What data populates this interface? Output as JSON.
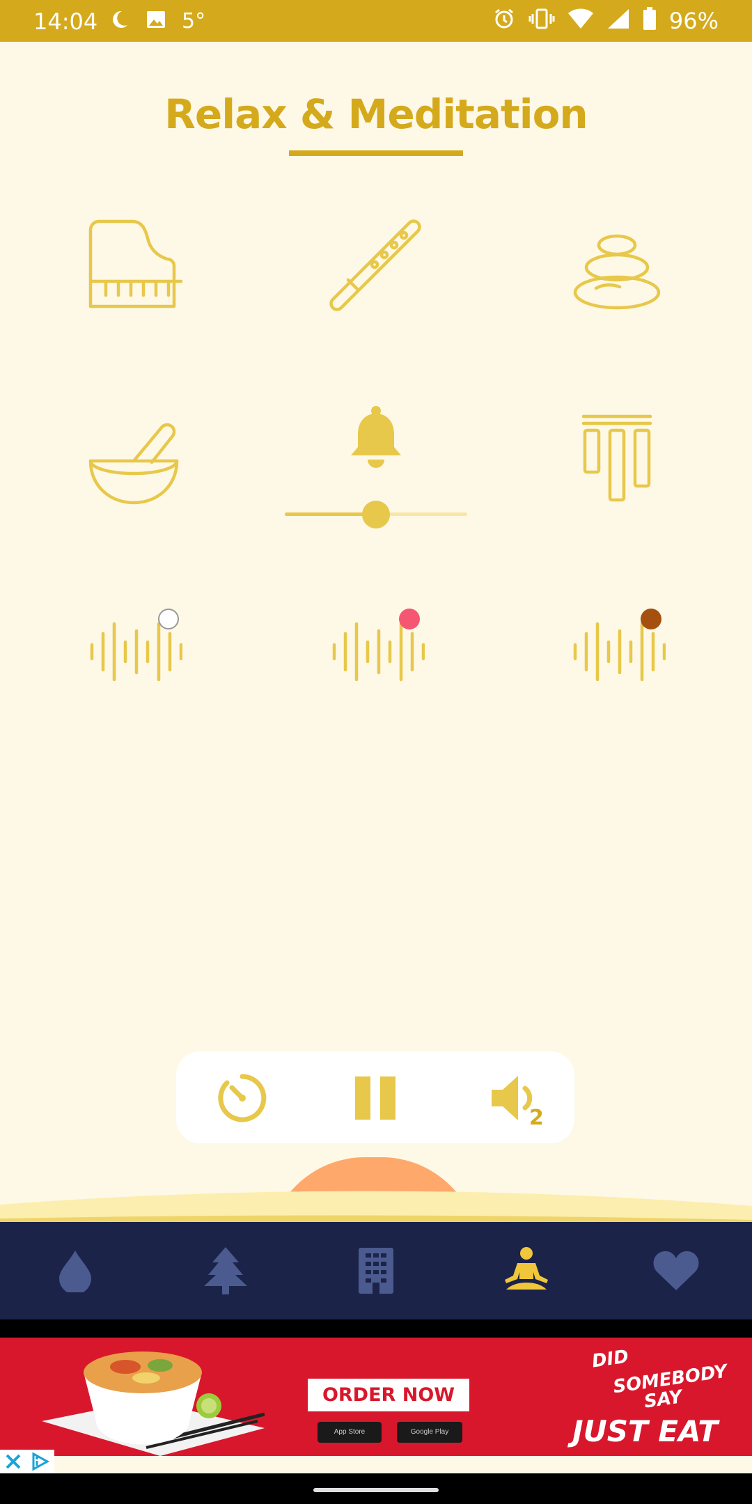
{
  "status_bar": {
    "time": "14:04",
    "temperature": "5°",
    "battery": "96%"
  },
  "page": {
    "title": "Relax & Meditation",
    "accent_color": "#d4aa1c"
  },
  "sounds": [
    {
      "name": "piano-icon",
      "active": false
    },
    {
      "name": "flute-icon",
      "active": false
    },
    {
      "name": "zen-stones-icon",
      "active": false
    },
    {
      "name": "singing-bowl-icon",
      "active": false
    },
    {
      "name": "bell-icon",
      "active": true,
      "volume": 0.5
    },
    {
      "name": "wind-chimes-icon",
      "active": false
    },
    {
      "name": "white-noise-icon",
      "dot_color": "#ffffff"
    },
    {
      "name": "pink-noise-icon",
      "dot_color": "#f55672"
    },
    {
      "name": "brown-noise-icon",
      "dot_color": "#a5500f"
    }
  ],
  "player": {
    "timer_icon": "timer-icon",
    "pause_icon": "pause-icon",
    "volume_icon": "volume-icon",
    "active_count": "2"
  },
  "bottom_nav": {
    "items": [
      {
        "icon": "water-drop-icon",
        "active": false
      },
      {
        "icon": "tree-icon",
        "active": false
      },
      {
        "icon": "city-icon",
        "active": false
      },
      {
        "icon": "meditation-icon",
        "active": true
      },
      {
        "icon": "heart-icon",
        "active": false
      }
    ]
  },
  "ad": {
    "cta": "ORDER NOW",
    "app_store": "App Store",
    "google_play": "Google Play",
    "tagline_1": "DID",
    "tagline_2": "SOMEBODY",
    "tagline_3": "SAY",
    "brand": "JUST EAT"
  }
}
